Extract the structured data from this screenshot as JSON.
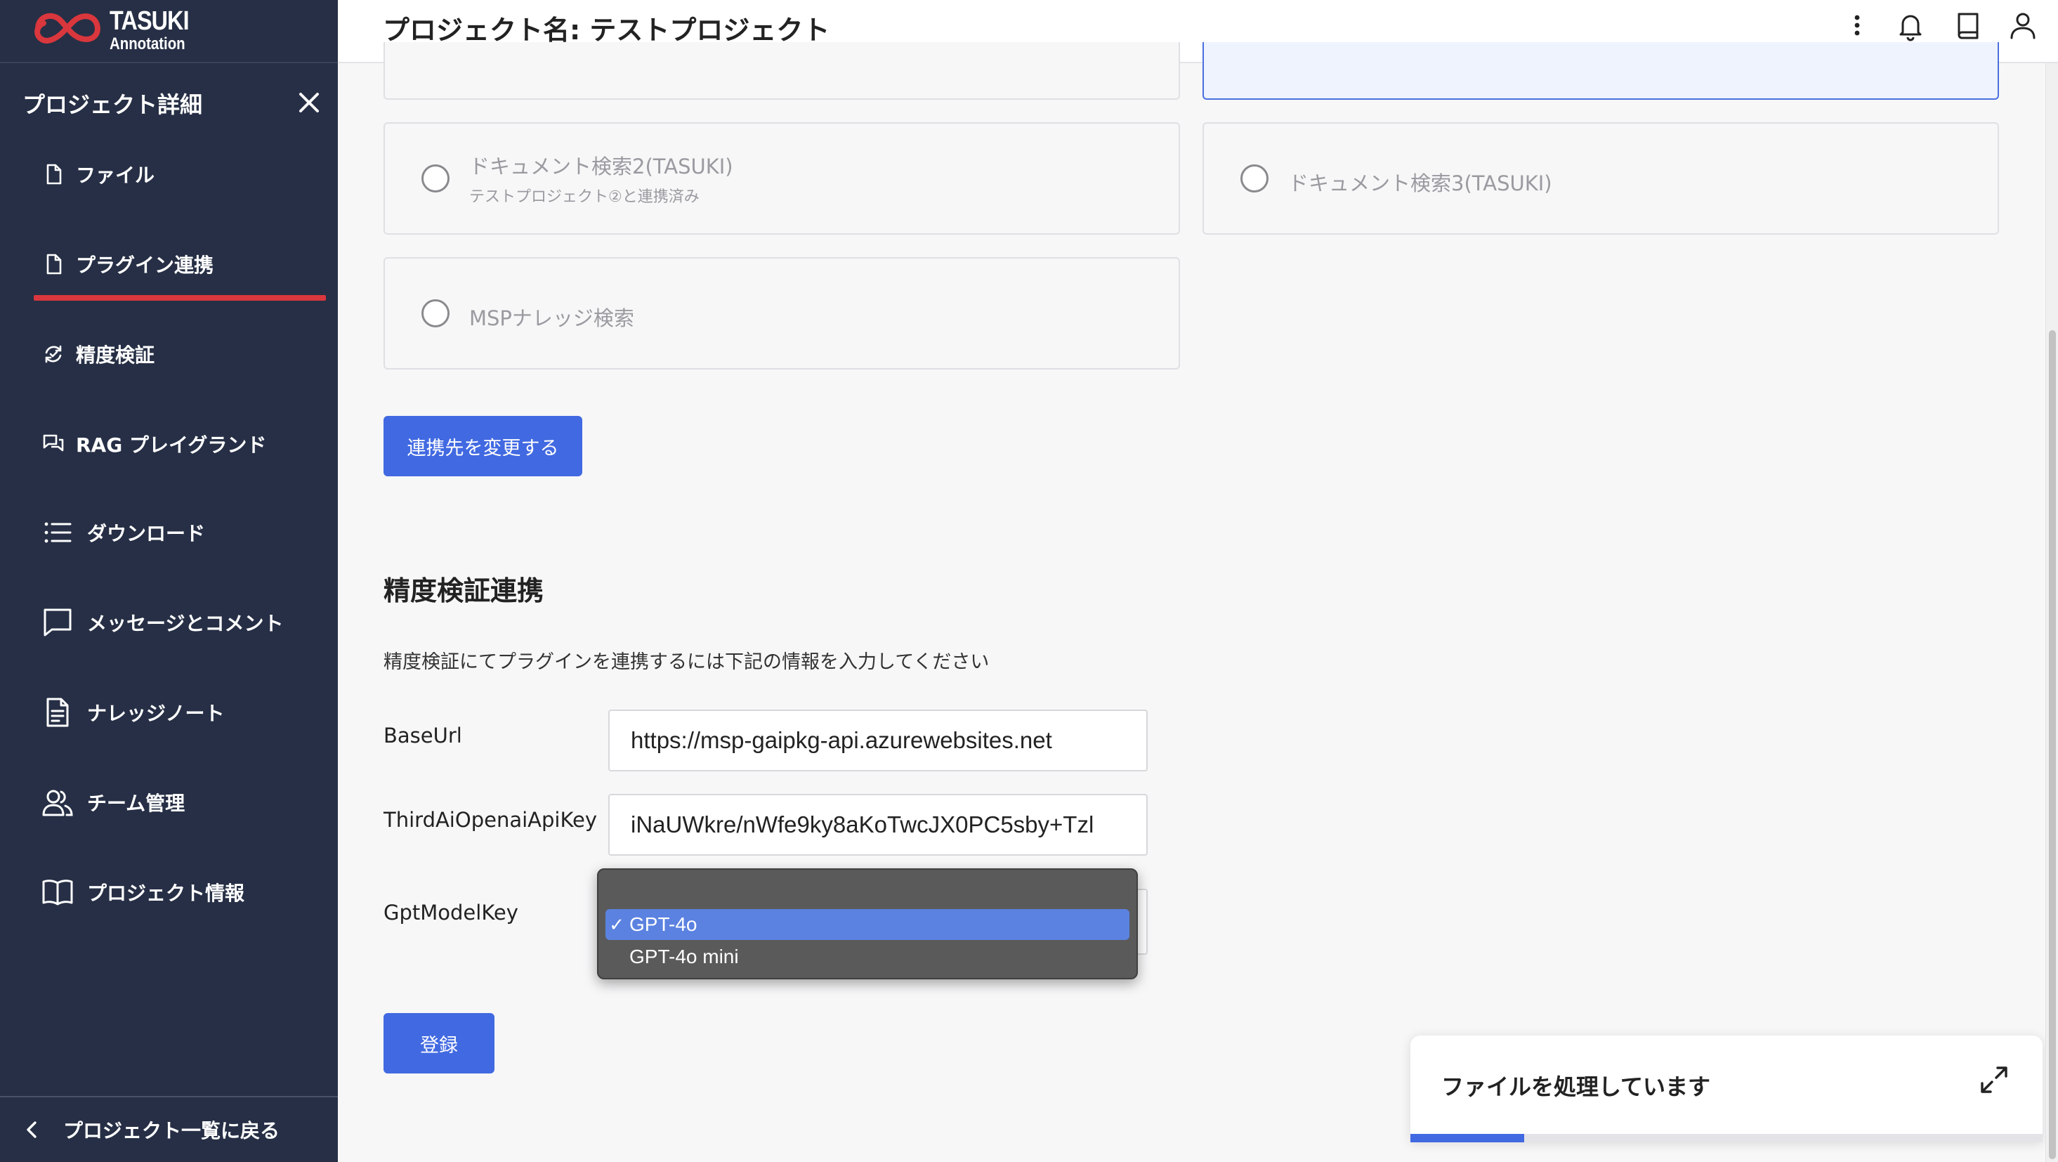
{
  "app": {
    "logo_line1": "TASUKI",
    "logo_line2": "Annotation",
    "brand_color": "#d9373d",
    "accent_color": "#4169e1"
  },
  "sidebar": {
    "title": "プロジェクト詳細",
    "items": [
      {
        "label": "ファイル",
        "icon": "file-icon"
      },
      {
        "label": "プラグイン連携",
        "icon": "file-icon",
        "active": true
      },
      {
        "label": "精度検証",
        "icon": "refresh-check-icon"
      },
      {
        "label": "RAG プレイグランド",
        "icon": "chat-bubbles-icon"
      },
      {
        "label": "ダウンロード",
        "icon": "list-icon"
      },
      {
        "label": "メッセージとコメント",
        "icon": "message-icon"
      },
      {
        "label": "ナレッジノート",
        "icon": "document-icon"
      },
      {
        "label": "チーム管理",
        "icon": "users-icon"
      },
      {
        "label": "プロジェクト情報",
        "icon": "book-icon"
      }
    ],
    "back_label": "プロジェクト一覧に戻る"
  },
  "header": {
    "title": "プロジェクト名: テストプロジェクト",
    "icons": [
      "more-vertical-icon",
      "bell-icon",
      "book-icon",
      "user-icon"
    ]
  },
  "plugins": {
    "options": [
      {
        "title": "ドキュメント検索2(TASUKI)",
        "subtitle": "テストプロジェクト②と連携済み"
      },
      {
        "title": "ドキュメント検索3(TASUKI)",
        "subtitle": ""
      },
      {
        "title": "MSPナレッジ検索",
        "subtitle": ""
      }
    ],
    "change_button": "連携先を変更する"
  },
  "accuracy": {
    "title": "精度検証連携",
    "description": "精度検証にてプラグインを連携するには下記の情報を入力してください",
    "fields": {
      "base_url_label": "BaseUrl",
      "base_url_value": "https://msp-gaipkg-api.azurewebsites.net",
      "api_key_label": "ThirdAiOpenaiApiKey",
      "api_key_value": "iNaUWkre/nWfe9ky8aKoTwcJX0PC5sby+Tzl",
      "model_label": "GptModelKey"
    },
    "model_options": [
      {
        "label": "GPT-4o",
        "selected": true
      },
      {
        "label": "GPT-4o mini",
        "selected": false
      }
    ],
    "check_mark": "✓",
    "submit_button": "登録"
  },
  "toast": {
    "title": "ファイルを処理しています",
    "progress": 0.18
  }
}
